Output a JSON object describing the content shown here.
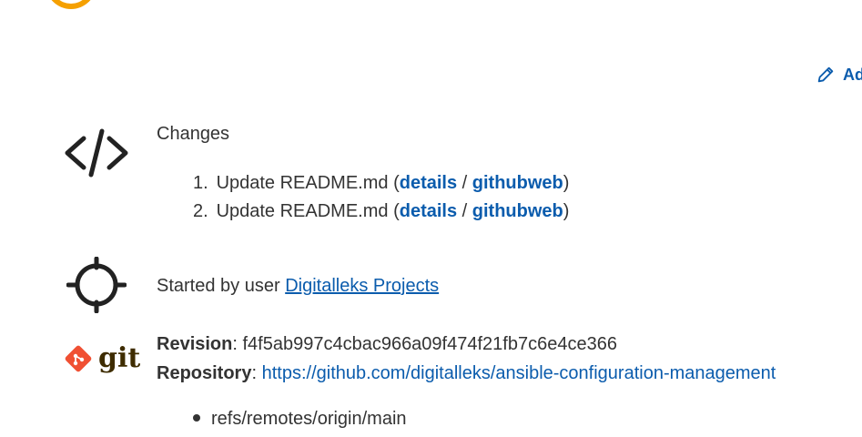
{
  "add_description": {
    "label": "Ad"
  },
  "changes": {
    "heading": "Changes",
    "items": [
      {
        "number": "1.",
        "text": "Update README.md (",
        "details": "details",
        "sep": " / ",
        "web": "githubweb",
        "close": ")"
      },
      {
        "number": "2.",
        "text": "Update README.md (",
        "details": "details",
        "sep": " / ",
        "web": "githubweb",
        "close": ")"
      }
    ]
  },
  "cause": {
    "prefix": "Started by user ",
    "user": "Digitalleks Projects"
  },
  "git": {
    "logo_text": "git",
    "revision_label": "Revision",
    "revision_value": ": f4f5ab997c4cbac966a09f474f21fb7c6e4ce366",
    "repository_label": "Repository",
    "repository_sep": ": ",
    "repository_url": "https://github.com/digitalleks/ansible-configuration-management",
    "refs": [
      "refs/remotes/origin/main"
    ]
  },
  "colors": {
    "link": "#0b5cad",
    "text": "#333333",
    "accent_orange": "#f5a000",
    "git_red": "#f05033"
  }
}
